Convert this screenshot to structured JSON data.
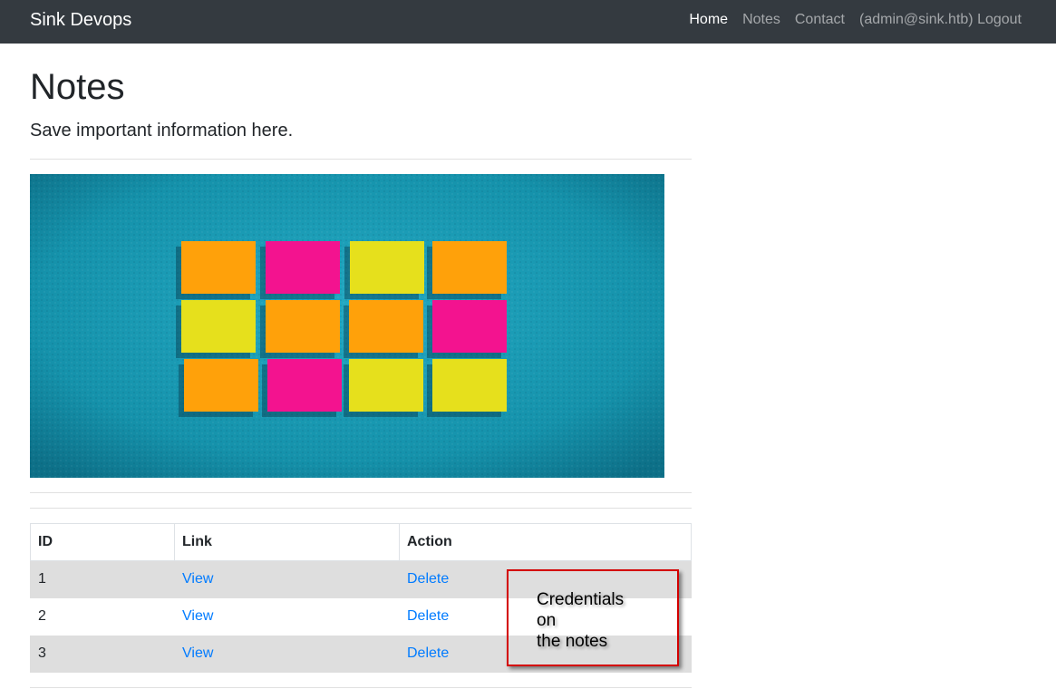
{
  "navbar": {
    "brand": "Sink Devops",
    "links": [
      {
        "label": "Home"
      },
      {
        "label": "Notes"
      },
      {
        "label": "Contact"
      },
      {
        "label": "(admin@sink.htb) Logout"
      }
    ]
  },
  "main": {
    "title": "Notes",
    "subtitle": "Save important information here."
  },
  "table": {
    "headers": [
      "ID",
      "Link",
      "Action"
    ],
    "rows": [
      {
        "id": "1",
        "link": "View",
        "action": "Delete"
      },
      {
        "id": "2",
        "link": "View",
        "action": "Delete"
      },
      {
        "id": "3",
        "link": "View",
        "action": "Delete"
      }
    ]
  },
  "annotation": {
    "text": "Credentials\non\nthe notes",
    "border_color": "#d40000"
  },
  "colors": {
    "navbar_bg": "#343a40",
    "link": "#007bff",
    "hero_bg": "#1b9ab3",
    "sticky_orange": "#ffa10a",
    "sticky_pink": "#f3138f",
    "sticky_yellow": "#e6e01c"
  }
}
